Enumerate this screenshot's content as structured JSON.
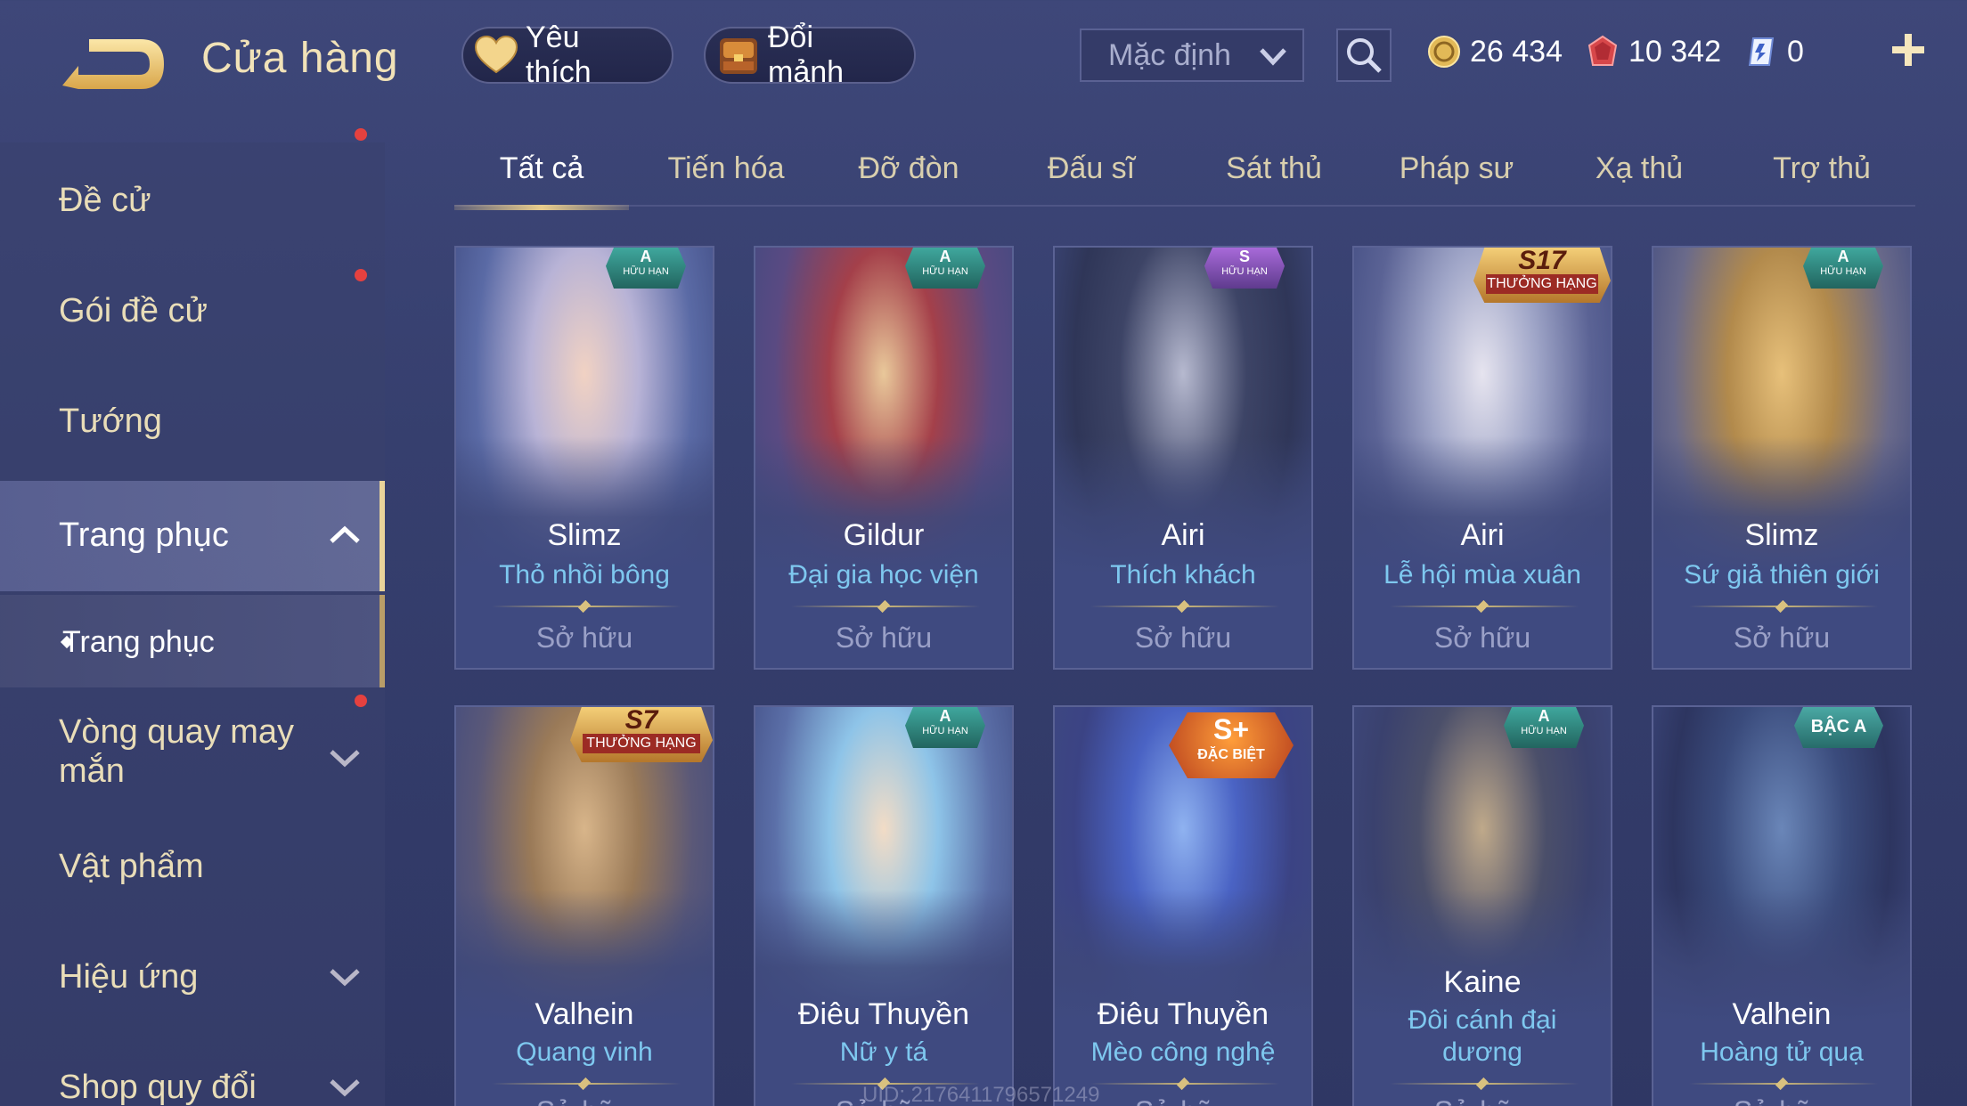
{
  "header": {
    "title": "Cửa hàng",
    "favorites_label": "Yêu thích",
    "exchange_label": "Đổi mảnh",
    "sort_value": "Mặc định",
    "gold": "26 434",
    "gems": "10 342",
    "vouchers": "0"
  },
  "sidebar": {
    "items": [
      {
        "label": "Đề cử"
      },
      {
        "label": "Gói đề cử"
      },
      {
        "label": "Tướng"
      },
      {
        "label": "Trang phục"
      },
      {
        "label": "Trang phục"
      },
      {
        "label": "Vòng quay may mắn"
      },
      {
        "label": "Vật phẩm"
      },
      {
        "label": "Hiệu ứng"
      },
      {
        "label": "Shop quy đổi"
      }
    ]
  },
  "tabs": [
    "Tất cả",
    "Tiến hóa",
    "Đỡ đòn",
    "Đấu sĩ",
    "Sát thủ",
    "Pháp sư",
    "Xạ thủ",
    "Trợ thủ"
  ],
  "cards": [
    {
      "hero": "Slimz",
      "skin": "Thỏ nhồi bông",
      "status": "Sở hữu",
      "badge_top": "A",
      "badge_bottom": "HỮU HẠN"
    },
    {
      "hero": "Gildur",
      "skin": "Đại gia học viện",
      "status": "Sở hữu",
      "badge_top": "A",
      "badge_bottom": "HỮU HẠN"
    },
    {
      "hero": "Airi",
      "skin": "Thích khách",
      "status": "Sở hữu",
      "badge_top": "S",
      "badge_bottom": "HỮU HẠN"
    },
    {
      "hero": "Airi",
      "skin": "Lễ hội mùa xuân",
      "status": "Sở hữu",
      "badge_top": "S17",
      "badge_bottom": "THƯỞNG HẠNG"
    },
    {
      "hero": "Slimz",
      "skin": "Sứ giả thiên giới",
      "status": "Sở hữu",
      "badge_top": "A",
      "badge_bottom": "HỮU HẠN"
    },
    {
      "hero": "Valhein",
      "skin": "Quang vinh",
      "status": "Sở hữu",
      "badge_top": "S7",
      "badge_bottom": "THƯỞNG HẠNG"
    },
    {
      "hero": "Điêu Thuyền",
      "skin": "Nữ y tá",
      "status": "Sở hữu",
      "badge_top": "A",
      "badge_bottom": "HỮU HẠN"
    },
    {
      "hero": "Điêu Thuyền",
      "skin": "Mèo công nghệ",
      "status": "Sở hữu",
      "badge_top": "S+",
      "badge_bottom": "ĐẶC BIỆT"
    },
    {
      "hero": "Kaine",
      "skin": "Đôi cánh đại dương",
      "status": "Sở hữu",
      "badge_top": "A",
      "badge_bottom": "HỮU HẠN"
    },
    {
      "hero": "Valhein",
      "skin": "Hoàng tử quạ",
      "status": "Sở hữu",
      "badge_top": "BẬC A",
      "badge_bottom": ""
    }
  ],
  "uid": "UID: 2176411796571249",
  "colors": {
    "background": "#3a4374",
    "accent_gold": "#e9cd8c",
    "skin_name": "#7ec8ef",
    "notification": "#e5413f"
  },
  "icons": {
    "back": "back-arrow-icon",
    "favorites": "heart-icon",
    "exchange": "treasure-chest-icon",
    "sort": "chevron-down-icon",
    "search": "search-icon",
    "gold": "gold-coin-icon",
    "gems": "ruby-gem-icon",
    "vouchers": "voucher-icon",
    "add": "plus-icon"
  }
}
